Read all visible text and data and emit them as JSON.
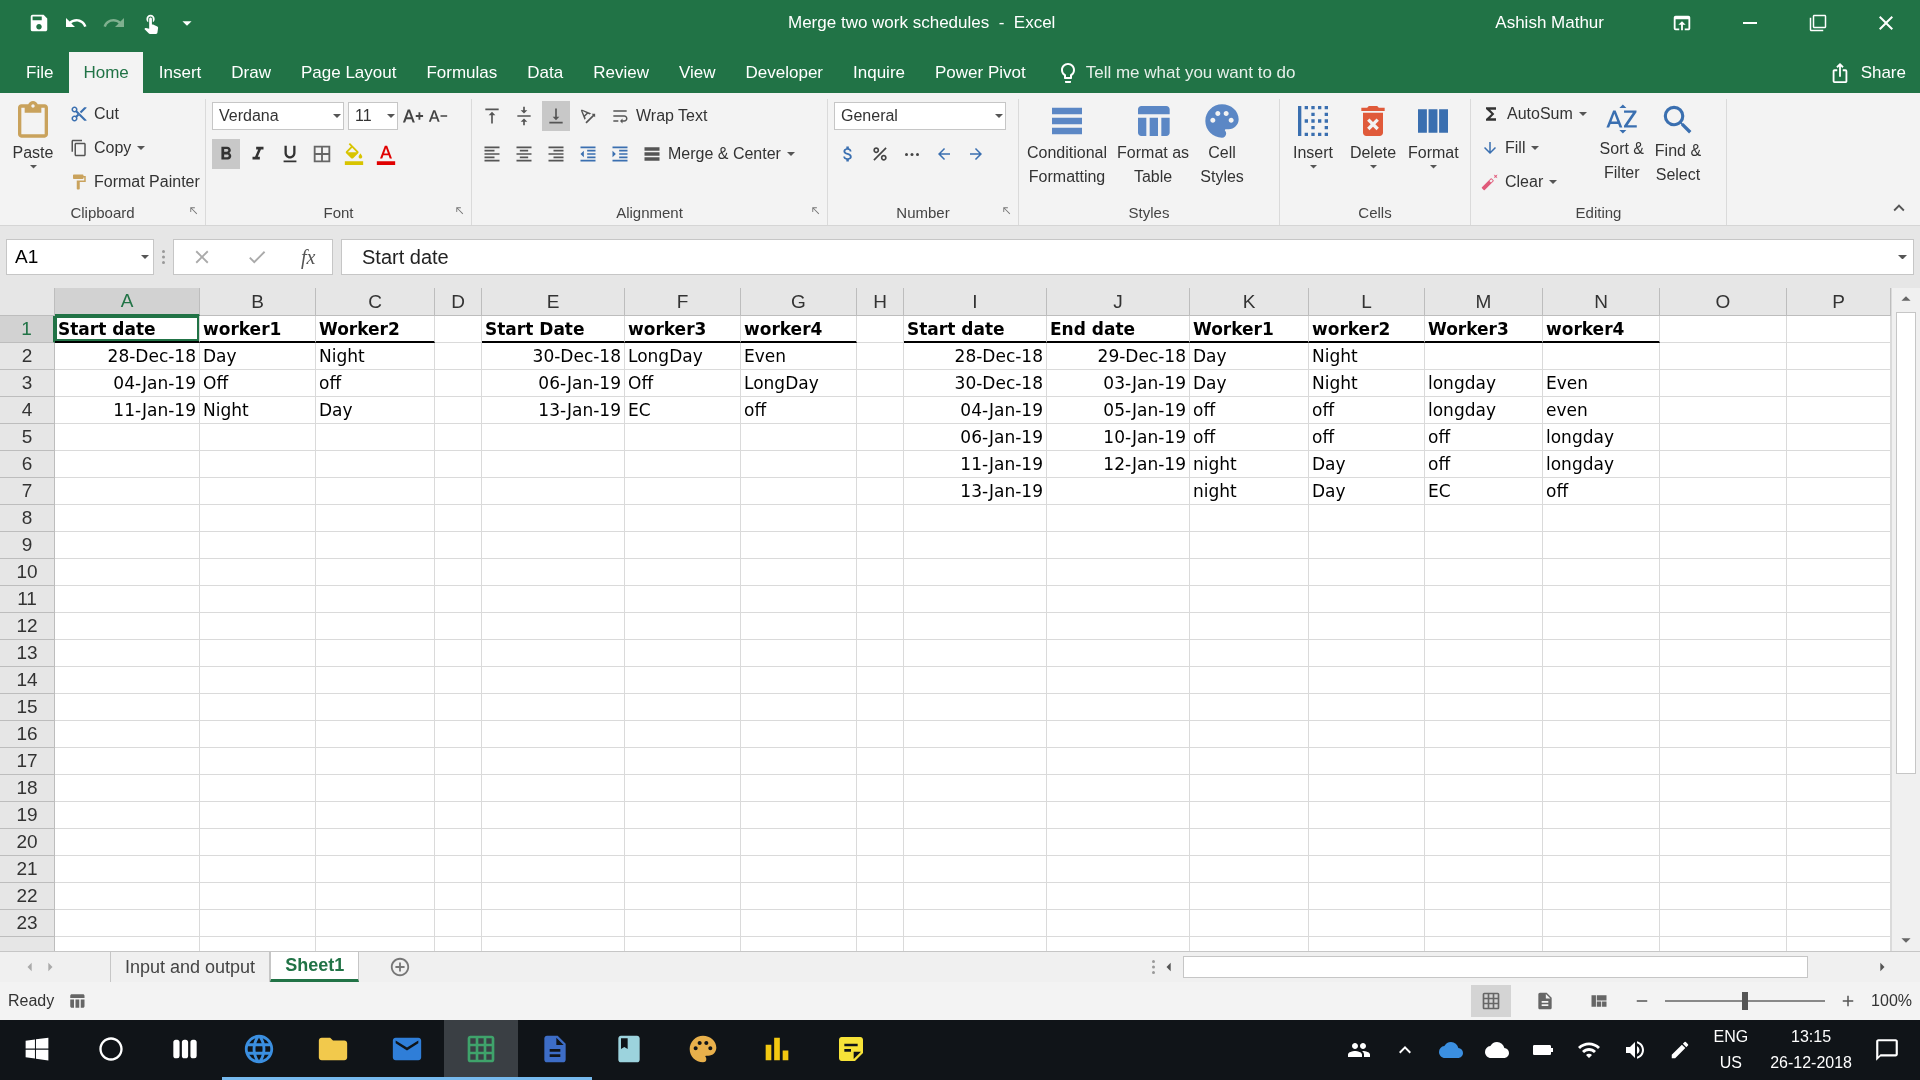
{
  "window": {
    "title": "Merge two work schedules  -  Excel",
    "user": "Ashish Mathur"
  },
  "menu_tabs": [
    {
      "label": "File",
      "selected": false
    },
    {
      "label": "Home",
      "selected": true
    },
    {
      "label": "Insert",
      "selected": false
    },
    {
      "label": "Draw",
      "selected": false
    },
    {
      "label": "Page Layout",
      "selected": false
    },
    {
      "label": "Formulas",
      "selected": false
    },
    {
      "label": "Data",
      "selected": false
    },
    {
      "label": "Review",
      "selected": false
    },
    {
      "label": "View",
      "selected": false
    },
    {
      "label": "Developer",
      "selected": false
    },
    {
      "label": "Inquire",
      "selected": false
    },
    {
      "label": "Power Pivot",
      "selected": false
    }
  ],
  "tell_me": {
    "placeholder": "Tell me what you want to do"
  },
  "share_button": "Share",
  "ribbon": {
    "clipboard": {
      "label": "Clipboard",
      "paste": "Paste",
      "cut": "Cut",
      "copy": "Copy",
      "format_painter": "Format Painter"
    },
    "font": {
      "label": "Font",
      "font_name": "Verdana",
      "font_size": "11",
      "bold": true
    },
    "alignment": {
      "label": "Alignment",
      "bottom_align": true,
      "wrap_text": "Wrap Text",
      "merge_center": "Merge & Center"
    },
    "number": {
      "label": "Number",
      "format": "General"
    },
    "styles": {
      "label": "Styles",
      "buttons": [
        "Conditional\nFormatting",
        "Format as\nTable",
        "Cell\nStyles"
      ]
    },
    "cells": {
      "label": "Cells",
      "buttons": [
        "Insert",
        "Delete",
        "Format"
      ]
    },
    "editing": {
      "label": "Editing",
      "autosum": "AutoSum",
      "fill": "Fill",
      "clear": "Clear",
      "sort_filter": "Sort &\nFilter",
      "find_select": "Find &\nSelect"
    }
  },
  "formula_bar": {
    "name_box": "A1",
    "function_symbol": "fx",
    "formula": "Start date"
  },
  "sheet": {
    "columns": [
      {
        "letter": "A",
        "selected": true
      },
      {
        "letter": "B",
        "selected": false
      },
      {
        "letter": "C",
        "selected": false
      },
      {
        "letter": "D",
        "selected": false
      },
      {
        "letter": "E",
        "selected": false
      },
      {
        "letter": "F",
        "selected": false
      },
      {
        "letter": "G",
        "selected": false
      },
      {
        "letter": "H",
        "selected": false
      },
      {
        "letter": "I",
        "selected": false
      },
      {
        "letter": "J",
        "selected": false
      },
      {
        "letter": "K",
        "selected": false
      },
      {
        "letter": "L",
        "selected": false
      },
      {
        "letter": "M",
        "selected": false
      },
      {
        "letter": "N",
        "selected": false
      },
      {
        "letter": "O",
        "selected": false
      },
      {
        "letter": "P",
        "selected": false
      }
    ],
    "rows": [
      {
        "number": "1",
        "selected": true,
        "cells": [
          {
            "text": "Start date",
            "kind": "header"
          },
          {
            "text": "worker1",
            "kind": "header"
          },
          {
            "text": "Worker2",
            "kind": "header"
          },
          null,
          {
            "text": "Start Date",
            "kind": "header"
          },
          {
            "text": "worker3",
            "kind": "header"
          },
          {
            "text": "worker4",
            "kind": "header"
          },
          null,
          {
            "text": "Start date",
            "kind": "header"
          },
          {
            "text": "End date",
            "kind": "header"
          },
          {
            "text": "Worker1",
            "kind": "header"
          },
          {
            "text": "worker2",
            "kind": "header"
          },
          {
            "text": "Worker3",
            "kind": "header"
          },
          {
            "text": "worker4",
            "kind": "header"
          },
          null,
          null
        ]
      },
      {
        "number": "2",
        "selected": false,
        "cells": [
          {
            "text": "28-Dec-18",
            "kind": "date"
          },
          {
            "text": "Day",
            "kind": "text"
          },
          {
            "text": "Night",
            "kind": "text"
          },
          null,
          {
            "text": "30-Dec-18",
            "kind": "date"
          },
          {
            "text": "LongDay",
            "kind": "text"
          },
          {
            "text": "Even",
            "kind": "text"
          },
          null,
          {
            "text": "28-Dec-18",
            "kind": "date"
          },
          {
            "text": "29-Dec-18",
            "kind": "date"
          },
          {
            "text": "Day",
            "kind": "text"
          },
          {
            "text": "Night",
            "kind": "text"
          },
          null,
          null,
          null,
          null
        ]
      },
      {
        "number": "3",
        "selected": false,
        "cells": [
          {
            "text": "04-Jan-19",
            "kind": "date"
          },
          {
            "text": "Off",
            "kind": "text"
          },
          {
            "text": "off",
            "kind": "text"
          },
          null,
          {
            "text": "06-Jan-19",
            "kind": "date"
          },
          {
            "text": "Off",
            "kind": "text"
          },
          {
            "text": "LongDay",
            "kind": "text"
          },
          null,
          {
            "text": "30-Dec-18",
            "kind": "date"
          },
          {
            "text": "03-Jan-19",
            "kind": "date"
          },
          {
            "text": "Day",
            "kind": "text"
          },
          {
            "text": "Night",
            "kind": "text"
          },
          {
            "text": "longday",
            "kind": "text"
          },
          {
            "text": "Even",
            "kind": "text"
          },
          null,
          null
        ]
      },
      {
        "number": "4",
        "selected": false,
        "cells": [
          {
            "text": "11-Jan-19",
            "kind": "date"
          },
          {
            "text": "Night",
            "kind": "text"
          },
          {
            "text": "Day",
            "kind": "text"
          },
          null,
          {
            "text": "13-Jan-19",
            "kind": "date"
          },
          {
            "text": "EC",
            "kind": "text"
          },
          {
            "text": "off",
            "kind": "text"
          },
          null,
          {
            "text": "04-Jan-19",
            "kind": "date"
          },
          {
            "text": "05-Jan-19",
            "kind": "date"
          },
          {
            "text": "off",
            "kind": "text"
          },
          {
            "text": "off",
            "kind": "text"
          },
          {
            "text": "longday",
            "kind": "text"
          },
          {
            "text": "even",
            "kind": "text"
          },
          null,
          null
        ]
      },
      {
        "number": "5",
        "selected": false,
        "cells": [
          null,
          null,
          null,
          null,
          null,
          null,
          null,
          null,
          {
            "text": "06-Jan-19",
            "kind": "date"
          },
          {
            "text": "10-Jan-19",
            "kind": "date"
          },
          {
            "text": "off",
            "kind": "text"
          },
          {
            "text": "off",
            "kind": "text"
          },
          {
            "text": "off",
            "kind": "text"
          },
          {
            "text": "longday",
            "kind": "text"
          },
          null,
          null
        ]
      },
      {
        "number": "6",
        "selected": false,
        "cells": [
          null,
          null,
          null,
          null,
          null,
          null,
          null,
          null,
          {
            "text": "11-Jan-19",
            "kind": "date"
          },
          {
            "text": "12-Jan-19",
            "kind": "date"
          },
          {
            "text": "night",
            "kind": "text"
          },
          {
            "text": "Day",
            "kind": "text"
          },
          {
            "text": "off",
            "kind": "text"
          },
          {
            "text": "longday",
            "kind": "text"
          },
          null,
          null
        ]
      },
      {
        "number": "7",
        "selected": false,
        "cells": [
          null,
          null,
          null,
          null,
          null,
          null,
          null,
          null,
          {
            "text": "13-Jan-19",
            "kind": "date"
          },
          null,
          {
            "text": "night",
            "kind": "text"
          },
          {
            "text": "Day",
            "kind": "text"
          },
          {
            "text": "EC",
            "kind": "text"
          },
          {
            "text": "off",
            "kind": "text"
          },
          null,
          null
        ]
      },
      {
        "number": "8",
        "selected": false,
        "cells": []
      },
      {
        "number": "9",
        "selected": false,
        "cells": []
      },
      {
        "number": "10",
        "selected": false,
        "cells": []
      },
      {
        "number": "11",
        "selected": false,
        "cells": []
      },
      {
        "number": "12",
        "selected": false,
        "cells": []
      },
      {
        "number": "13",
        "selected": false,
        "cells": []
      },
      {
        "number": "14",
        "selected": false,
        "cells": []
      },
      {
        "number": "15",
        "selected": false,
        "cells": []
      },
      {
        "number": "16",
        "selected": false,
        "cells": []
      },
      {
        "number": "17",
        "selected": false,
        "cells": []
      },
      {
        "number": "18",
        "selected": false,
        "cells": []
      },
      {
        "number": "19",
        "selected": false,
        "cells": []
      },
      {
        "number": "20",
        "selected": false,
        "cells": []
      },
      {
        "number": "21",
        "selected": false,
        "cells": []
      },
      {
        "number": "22",
        "selected": false,
        "cells": []
      },
      {
        "number": "23",
        "selected": false,
        "cells": []
      }
    ]
  },
  "sheet_tabs": [
    {
      "label": "Input and output",
      "selected": false
    },
    {
      "label": "Sheet1",
      "selected": true
    }
  ],
  "status_bar": {
    "status": "Ready",
    "views": [
      {
        "selected": true
      },
      {
        "selected": false
      },
      {
        "selected": false
      }
    ],
    "zoom_slider": {
      "level": 0.5
    },
    "zoom": "100%"
  },
  "taskbar": {
    "apps": [
      {
        "kind": "edge",
        "running": true,
        "active": false
      },
      {
        "kind": "explorer",
        "running": true,
        "active": false
      },
      {
        "kind": "outlook",
        "running": true,
        "active": false
      },
      {
        "kind": "excel",
        "running": true,
        "active": true
      },
      {
        "kind": "word",
        "running": true,
        "active": false
      },
      {
        "kind": "notebook",
        "running": false,
        "active": false
      },
      {
        "kind": "paint",
        "running": false,
        "active": false
      },
      {
        "kind": "powerbi",
        "running": false,
        "active": false
      },
      {
        "kind": "notes",
        "running": false,
        "active": false
      }
    ],
    "language": "ENG",
    "region": "US",
    "time": "13:15",
    "date": "26-12-2018"
  }
}
